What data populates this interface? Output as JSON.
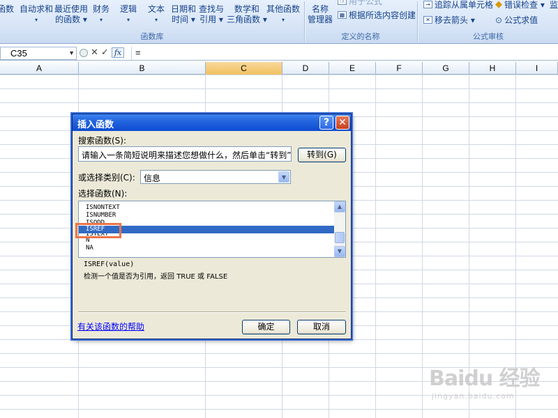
{
  "ribbon": {
    "insert_fn": "函数",
    "autosum": {
      "l1": "自动求和",
      "l2": "▾"
    },
    "recent": {
      "l1": "最近使用",
      "l2": "的函数 ▾"
    },
    "finance": {
      "l1": "财务",
      "l2": "▾"
    },
    "logic": {
      "l1": "逻辑",
      "l2": "▾"
    },
    "text": {
      "l1": "文本",
      "l2": "▾"
    },
    "datetime": {
      "l1": "日期和",
      "l2": "时间 ▾"
    },
    "lookup": {
      "l1": "查找与",
      "l2": "引用 ▾"
    },
    "math": {
      "l1": "数学和",
      "l2": "三角函数 ▾"
    },
    "other": {
      "l1": "其他函数",
      "l2": "▾"
    },
    "group_library": "函数库",
    "name_mgr": {
      "l1": "名称",
      "l2": "管理器"
    },
    "use_formula": "用于公式",
    "create_sel": "根据所选内容创建",
    "group_names": "定义的名称",
    "trace": "追踪从属单元格",
    "remove_arrows": "移去箭头 ▾",
    "error_check": "错误检查 ▾",
    "eval_formula": "公式求值",
    "group_audit": "公式审核",
    "watch": "监"
  },
  "formula_bar": {
    "name_box": "C35",
    "fx": "fx",
    "cancel": "✕",
    "enter": "✓",
    "value": "="
  },
  "columns": [
    "A",
    "B",
    "C",
    "D",
    "E",
    "F",
    "G",
    "H",
    "I"
  ],
  "dialog": {
    "title": "插入函数",
    "help_btn": "?",
    "close_btn": "✕",
    "search_label": "搜索函数(S):",
    "search_value": "请输入一条简短说明来描述您想做什么，然后单击“转到”",
    "go_btn": "转到(G)",
    "category_label": "或选择类别(C):",
    "category_value": "信息",
    "select_label": "选择函数(N):",
    "functions": [
      "ISNONTEXT",
      "ISNUMBER",
      "ISODD",
      "",
      "ISREF",
      "ISTEXT",
      "N",
      "NA"
    ],
    "syntax": "ISREF(value)",
    "description": "检测一个值是否为引用，返回 TRUE 或 FALSE",
    "help_link": "有关该函数的帮助",
    "ok": "确定",
    "cancel": "取消"
  },
  "watermark": {
    "big": "Baidu 经验",
    "small": "jingyan.baidu.com"
  }
}
